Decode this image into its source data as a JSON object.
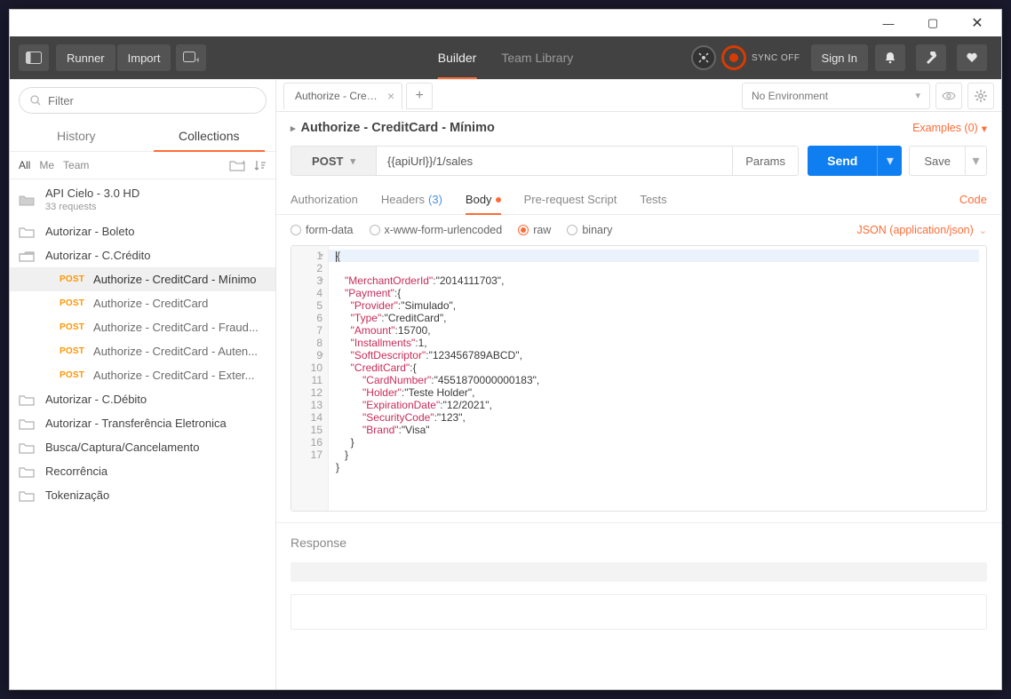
{
  "window": {
    "min": "—",
    "max": "▢",
    "close": "✕"
  },
  "topbar": {
    "runner": "Runner",
    "import": "Import",
    "tabs": {
      "builder": "Builder",
      "team": "Team Library"
    },
    "sync": "SYNC OFF",
    "signin": "Sign In"
  },
  "sidebar": {
    "filter_placeholder": "Filter",
    "tabs": {
      "history": "History",
      "collections": "Collections"
    },
    "scope": {
      "all": "All",
      "me": "Me",
      "team": "Team"
    },
    "collection": {
      "name": "API Cielo - 3.0 HD",
      "sub": "33 requests"
    },
    "folders": [
      {
        "label": "Autorizar - Boleto"
      },
      {
        "label": "Autorizar - C.Crédito",
        "open": true,
        "items": [
          {
            "method": "POST",
            "label": "Authorize - CreditCard - Mínimo",
            "selected": true
          },
          {
            "method": "POST",
            "label": "Authorize - CreditCard"
          },
          {
            "method": "POST",
            "label": "Authorize - CreditCard - Fraud..."
          },
          {
            "method": "POST",
            "label": "Authorize - CreditCard - Auten..."
          },
          {
            "method": "POST",
            "label": "Authorize - CreditCard - Exter..."
          }
        ]
      },
      {
        "label": "Autorizar - C.Débito"
      },
      {
        "label": "Autorizar - Transferência Eletronica"
      },
      {
        "label": "Busca/Captura/Cancelamento"
      },
      {
        "label": "Recorrência"
      },
      {
        "label": "Tokenização"
      }
    ]
  },
  "main": {
    "tab_name": "Authorize - CreditCard - Mínimo",
    "env": "No Environment",
    "title": "Authorize - CreditCard - Mínimo",
    "examples": "Examples (0)",
    "method": "POST",
    "url": "{{apiUrl}}/1/sales",
    "params": "Params",
    "send": "Send",
    "save": "Save",
    "tabs": {
      "auth": "Authorization",
      "headers": "Headers",
      "headers_count": "(3)",
      "body": "Body",
      "prereq": "Pre-request Script",
      "tests": "Tests",
      "code": "Code"
    },
    "body_types": {
      "form": "form-data",
      "url": "x-www-form-urlencoded",
      "raw": "raw",
      "bin": "binary",
      "ct": "JSON (application/json)"
    },
    "response": "Response",
    "editor_lines": [
      "{",
      "   \"MerchantOrderId\":\"2014111703\",",
      "   \"Payment\":{",
      "     \"Provider\":\"Simulado\",",
      "     \"Type\":\"CreditCard\",",
      "     \"Amount\":15700,",
      "     \"Installments\":1,",
      "     \"SoftDescriptor\":\"123456789ABCD\",",
      "     \"CreditCard\":{",
      "         \"CardNumber\":\"4551870000000183\",",
      "         \"Holder\":\"Teste Holder\",",
      "         \"ExpirationDate\":\"12/2021\",",
      "         \"SecurityCode\":\"123\",",
      "         \"Brand\":\"Visa\"",
      "     }",
      "   }",
      "}"
    ],
    "fold_lines": [
      1,
      3,
      9
    ]
  }
}
